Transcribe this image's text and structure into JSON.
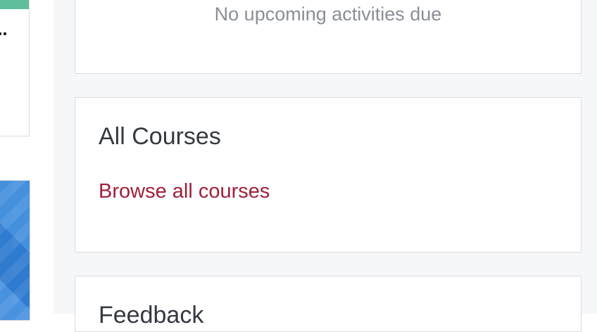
{
  "timeline": {
    "empty_message": "No upcoming activities due"
  },
  "all_courses": {
    "title": "All Courses",
    "link_label": "Browse all courses"
  },
  "feedback": {
    "title": "Feedback"
  },
  "colors": {
    "link": "#a0203a",
    "course_accent": "#5fbf9b",
    "course_image": "#3a86d8",
    "drawer_background": "#f6f7f9"
  }
}
